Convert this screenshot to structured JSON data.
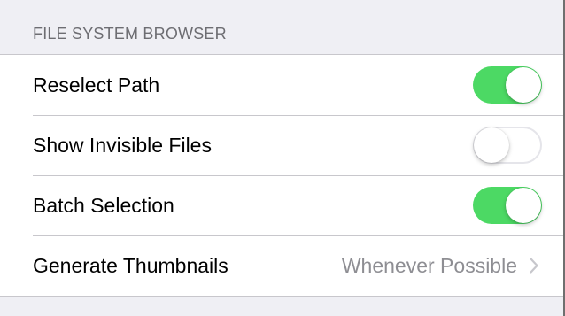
{
  "section": {
    "title": "FILE SYSTEM BROWSER"
  },
  "rows": [
    {
      "label": "Reselect Path",
      "control": "toggle",
      "value": true
    },
    {
      "label": "Show Invisible Files",
      "control": "toggle",
      "value": false
    },
    {
      "label": "Batch Selection",
      "control": "toggle",
      "value": true
    },
    {
      "label": "Generate Thumbnails",
      "control": "disclosure",
      "detail": "Whenever Possible",
      "icon": "chevron-right-icon"
    }
  ],
  "colors": {
    "toggle_on": "#4cd964",
    "toggle_off_border": "#e5e5ea",
    "background": "#efeff4",
    "secondary_text": "#8e8e93"
  }
}
